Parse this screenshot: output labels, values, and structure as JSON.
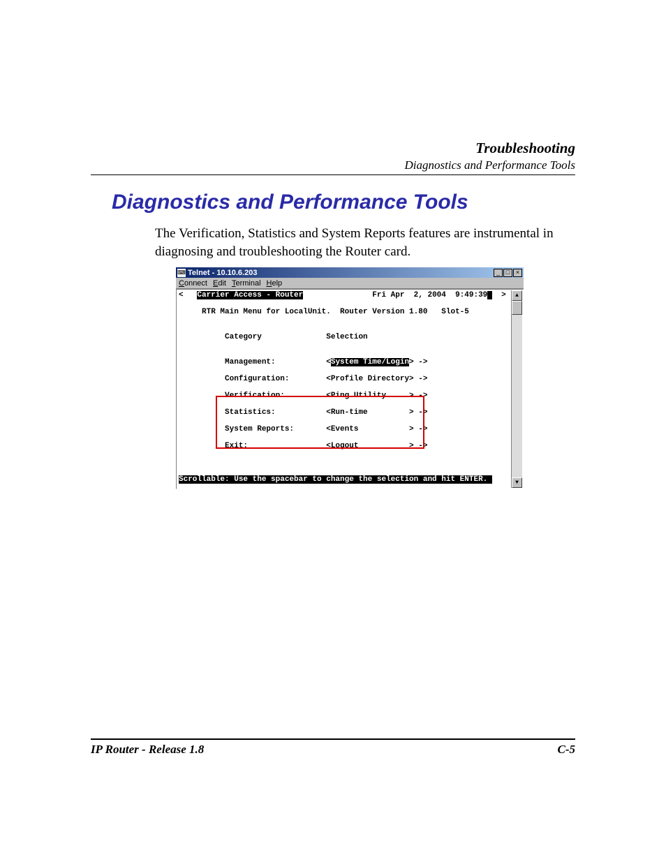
{
  "header": {
    "title": "Troubleshooting",
    "subtitle": "Diagnostics and Performance Tools"
  },
  "section_title": "Diagnostics and Performance Tools",
  "body_text": "The Verification, Statistics and System Reports features are instrumental in diagnosing and troubleshooting the Router card.",
  "telnet": {
    "window_title": "Telnet - 10.10.6.203",
    "menu": {
      "connect": "Connect",
      "edit": "Edit",
      "terminal": "Terminal",
      "help": "Help"
    },
    "top_left_marker": "<",
    "banner": "Carrier Access - Router",
    "datetime": "Fri Apr  2, 2004  9:49:39",
    "right_marker": ">",
    "subtitle_line": "     RTR Main Menu for LocalUnit.  Router Version 1.80   Slot-5",
    "col_headers": {
      "category": "Category",
      "selection": "Selection"
    },
    "rows": [
      {
        "label": "Management:",
        "value": "<System Time/Login> ->",
        "highlighted_value": "System Time/Login"
      },
      {
        "label": "Configuration:",
        "value": "<Profile Directory> ->"
      },
      {
        "label": "Verification:",
        "value": "<Ping Utility     > ->"
      },
      {
        "label": "Statistics:",
        "value": "<Run-time         > ->"
      },
      {
        "label": "System Reports:",
        "value": "<Events           > ->"
      },
      {
        "label": "Exit:",
        "value": "<Logout           > ->"
      }
    ],
    "status_line": "Scrollable: Use the spacebar to change the selection and hit ENTER."
  },
  "titlebar_buttons": {
    "minimize": "_",
    "maximize": "□",
    "close": "×"
  },
  "scrollbar": {
    "up": "▲",
    "down": "▼"
  },
  "footer": {
    "left": "IP Router - Release 1.8",
    "right": "C-5"
  }
}
